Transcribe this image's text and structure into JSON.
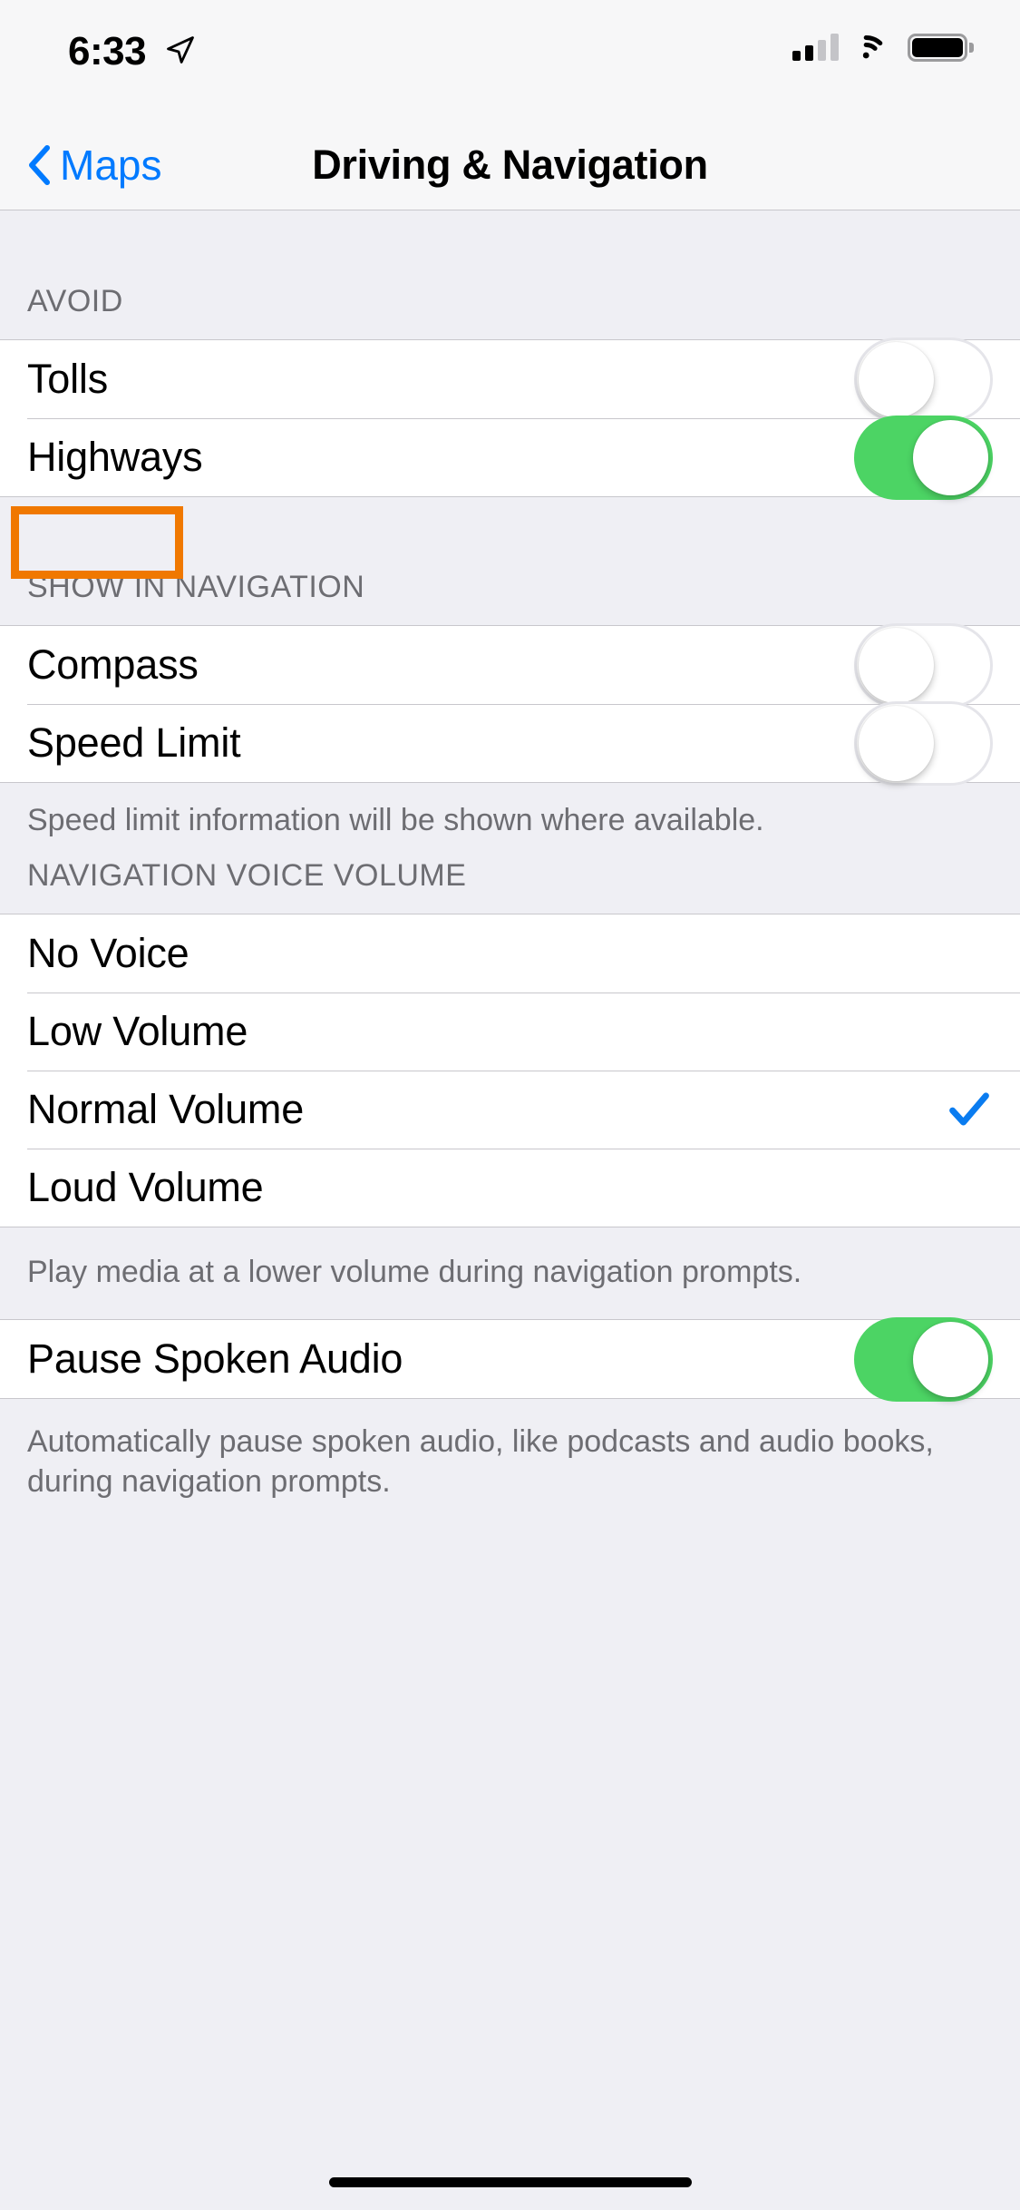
{
  "status_bar": {
    "time": "6:33",
    "location_icon": "location-arrow-icon",
    "cellular_icon": "cellular-signal-icon",
    "cellular_bars_filled": 2,
    "cellular_bars_total": 4,
    "wifi_icon": "wifi-icon",
    "battery_icon": "battery-full-icon"
  },
  "nav": {
    "back_label": "Maps",
    "back_icon": "chevron-left-icon",
    "title": "Driving & Navigation"
  },
  "sections": [
    {
      "header": "AVOID",
      "rows": [
        {
          "label": "Tolls",
          "control": "toggle",
          "value": "off"
        },
        {
          "label": "Highways",
          "control": "toggle",
          "value": "on",
          "highlighted": true
        }
      ],
      "footer": ""
    },
    {
      "header": "SHOW IN NAVIGATION",
      "rows": [
        {
          "label": "Compass",
          "control": "toggle",
          "value": "off"
        },
        {
          "label": "Speed Limit",
          "control": "toggle",
          "value": "off"
        }
      ],
      "footer": "Speed limit information will be shown where available."
    },
    {
      "header": "NAVIGATION VOICE VOLUME",
      "rows": [
        {
          "label": "No Voice",
          "control": "checkmark",
          "value": "unselected"
        },
        {
          "label": "Low Volume",
          "control": "checkmark",
          "value": "unselected"
        },
        {
          "label": "Normal Volume",
          "control": "checkmark",
          "value": "selected"
        },
        {
          "label": "Loud Volume",
          "control": "checkmark",
          "value": "unselected"
        }
      ],
      "footer": "Play media at a lower volume during navigation prompts."
    },
    {
      "header": "",
      "rows": [
        {
          "label": "Pause Spoken Audio",
          "control": "toggle",
          "value": "on"
        }
      ],
      "footer": "Automatically pause spoken audio, like podcasts and audio books, during navigation prompts."
    }
  ],
  "colors": {
    "accent_blue": "#007AFF",
    "toggle_on_green": "#4CD464",
    "annotation_orange": "#F07800",
    "group_background": "#FFFFFF",
    "page_background": "#EFEFF4",
    "secondary_text": "#6D6D72",
    "separator": "#C8C7CC"
  },
  "annotation": {
    "target": "Highways",
    "shape": "rectangle",
    "color": "#F07800"
  }
}
